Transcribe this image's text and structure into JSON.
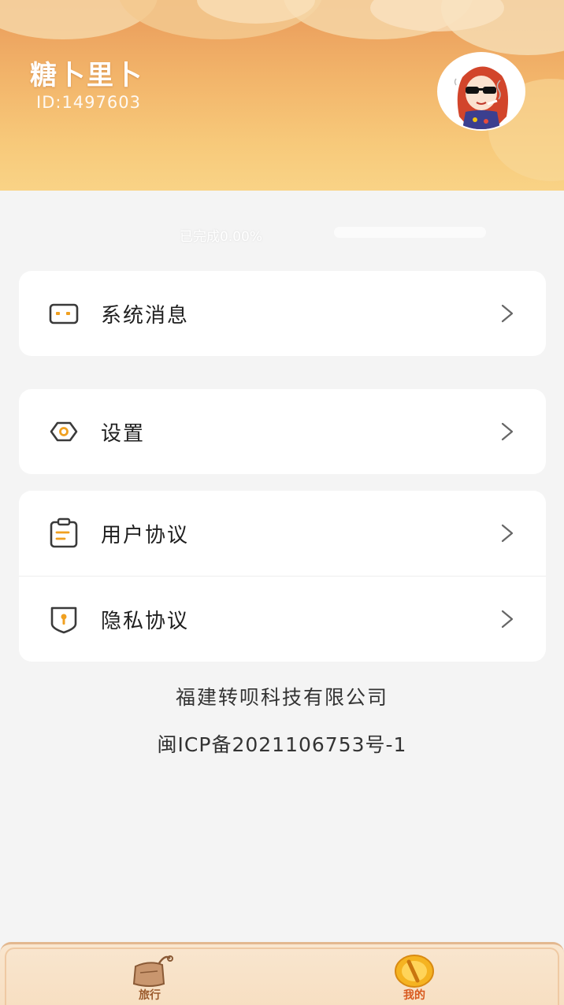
{
  "profile": {
    "username": "糖卜里卜",
    "user_id": "ID:1497603",
    "avatar_icon": "avatar-cartoon-girl-sunglasses"
  },
  "progress": {
    "text": "已完成0.00%",
    "fraction": 0.0
  },
  "menu": {
    "system_messages": {
      "label": "系统消息",
      "icon": "message-box-icon"
    },
    "settings": {
      "label": "设置",
      "icon": "hexagon-gear-icon"
    },
    "user_agreement": {
      "label": "用户协议",
      "icon": "clipboard-icon"
    },
    "privacy_agreement": {
      "label": "隐私协议",
      "icon": "shield-keyhole-icon"
    }
  },
  "footer": {
    "company": "福建转呗科技有限公司",
    "icp": "闽ICP备2021106753号-1"
  },
  "tabbar": {
    "tabs": [
      {
        "label": "旅行",
        "icon": "travel-bag-icon",
        "active": false
      },
      {
        "label": "我的",
        "icon": "gold-coin-icon",
        "active": true
      }
    ]
  },
  "colors": {
    "header_top": "#e99a5a",
    "header_bottom": "#f9d386",
    "icon_stroke": "#3a3a3a",
    "icon_accent": "#f0a020",
    "active_tab": "#d8581d"
  }
}
